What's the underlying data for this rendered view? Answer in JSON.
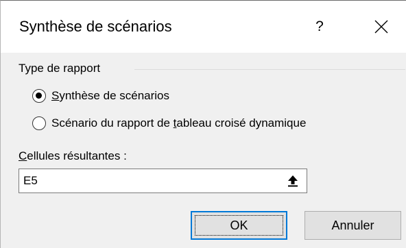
{
  "dialog": {
    "title": "Synthèse de scénarios",
    "help_label": "?",
    "close_icon": "close-icon"
  },
  "report_type": {
    "label": "Type de rapport",
    "options": [
      {
        "pre": "",
        "accel": "S",
        "post": "ynthèse de scénarios",
        "checked": true
      },
      {
        "pre": "Scénario du rapport de ",
        "accel": "t",
        "post": "ableau croisé dynamique",
        "checked": false
      }
    ]
  },
  "result_cells": {
    "label_accel": "C",
    "label_rest": "ellules résultantes :",
    "value": "E5",
    "collapse_icon": "collapse-dialog-icon"
  },
  "buttons": {
    "ok_label": "OK",
    "cancel_label": "Annuler"
  },
  "colors": {
    "dialog_bg": "#f0f0f0",
    "titlebar_bg": "#ffffff",
    "focus_border": "#0078d7",
    "button_bg": "#e1e1e1"
  }
}
